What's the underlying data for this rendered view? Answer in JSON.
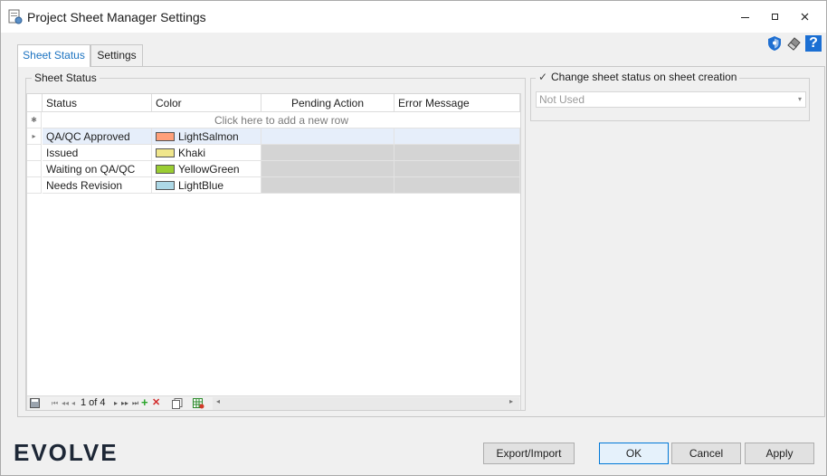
{
  "window": {
    "title": "Project Sheet Manager Settings",
    "minimize": "—",
    "maximize": "☐",
    "close": "✕"
  },
  "tabs": [
    {
      "label": "Sheet Status",
      "active": true
    },
    {
      "label": "Settings",
      "active": false
    }
  ],
  "top_icons": [
    "shield-icon",
    "eraser-icon",
    "help-icon"
  ],
  "help_label": "?",
  "sheet_status_group": {
    "title": "Sheet Status",
    "columns": [
      "Status",
      "Color",
      "Pending Action",
      "Error Message"
    ],
    "new_row_text": "Click here to add a new row",
    "rows": [
      {
        "status": "QA/QC Approved",
        "color_name": "LightSalmon",
        "color": "#FFA07A"
      },
      {
        "status": "Issued",
        "color_name": "Khaki",
        "color": "#F0E68C"
      },
      {
        "status": "Waiting on QA/QC",
        "color_name": "YellowGreen",
        "color": "#9ACD32"
      },
      {
        "status": "Needs Revision",
        "color_name": "LightBlue",
        "color": "#ADD8E6"
      }
    ],
    "navigator": {
      "position": "1 of 4",
      "first": "⏮",
      "prev_page": "◂◂",
      "prev": "◂",
      "next": "▸",
      "next_page": "▸▸",
      "last": "⏭",
      "add": "+",
      "remove": "✕",
      "scroll_left": "◂",
      "scroll_right": "▸"
    }
  },
  "status_on_creation": {
    "label": "Change sheet status on sheet creation",
    "checked": true,
    "check_mark": "✓",
    "select_value": "Not Used"
  },
  "footer": {
    "logo": "EVOLVE",
    "export_import": "Export/Import",
    "ok": "OK",
    "cancel": "Cancel",
    "apply": "Apply"
  }
}
